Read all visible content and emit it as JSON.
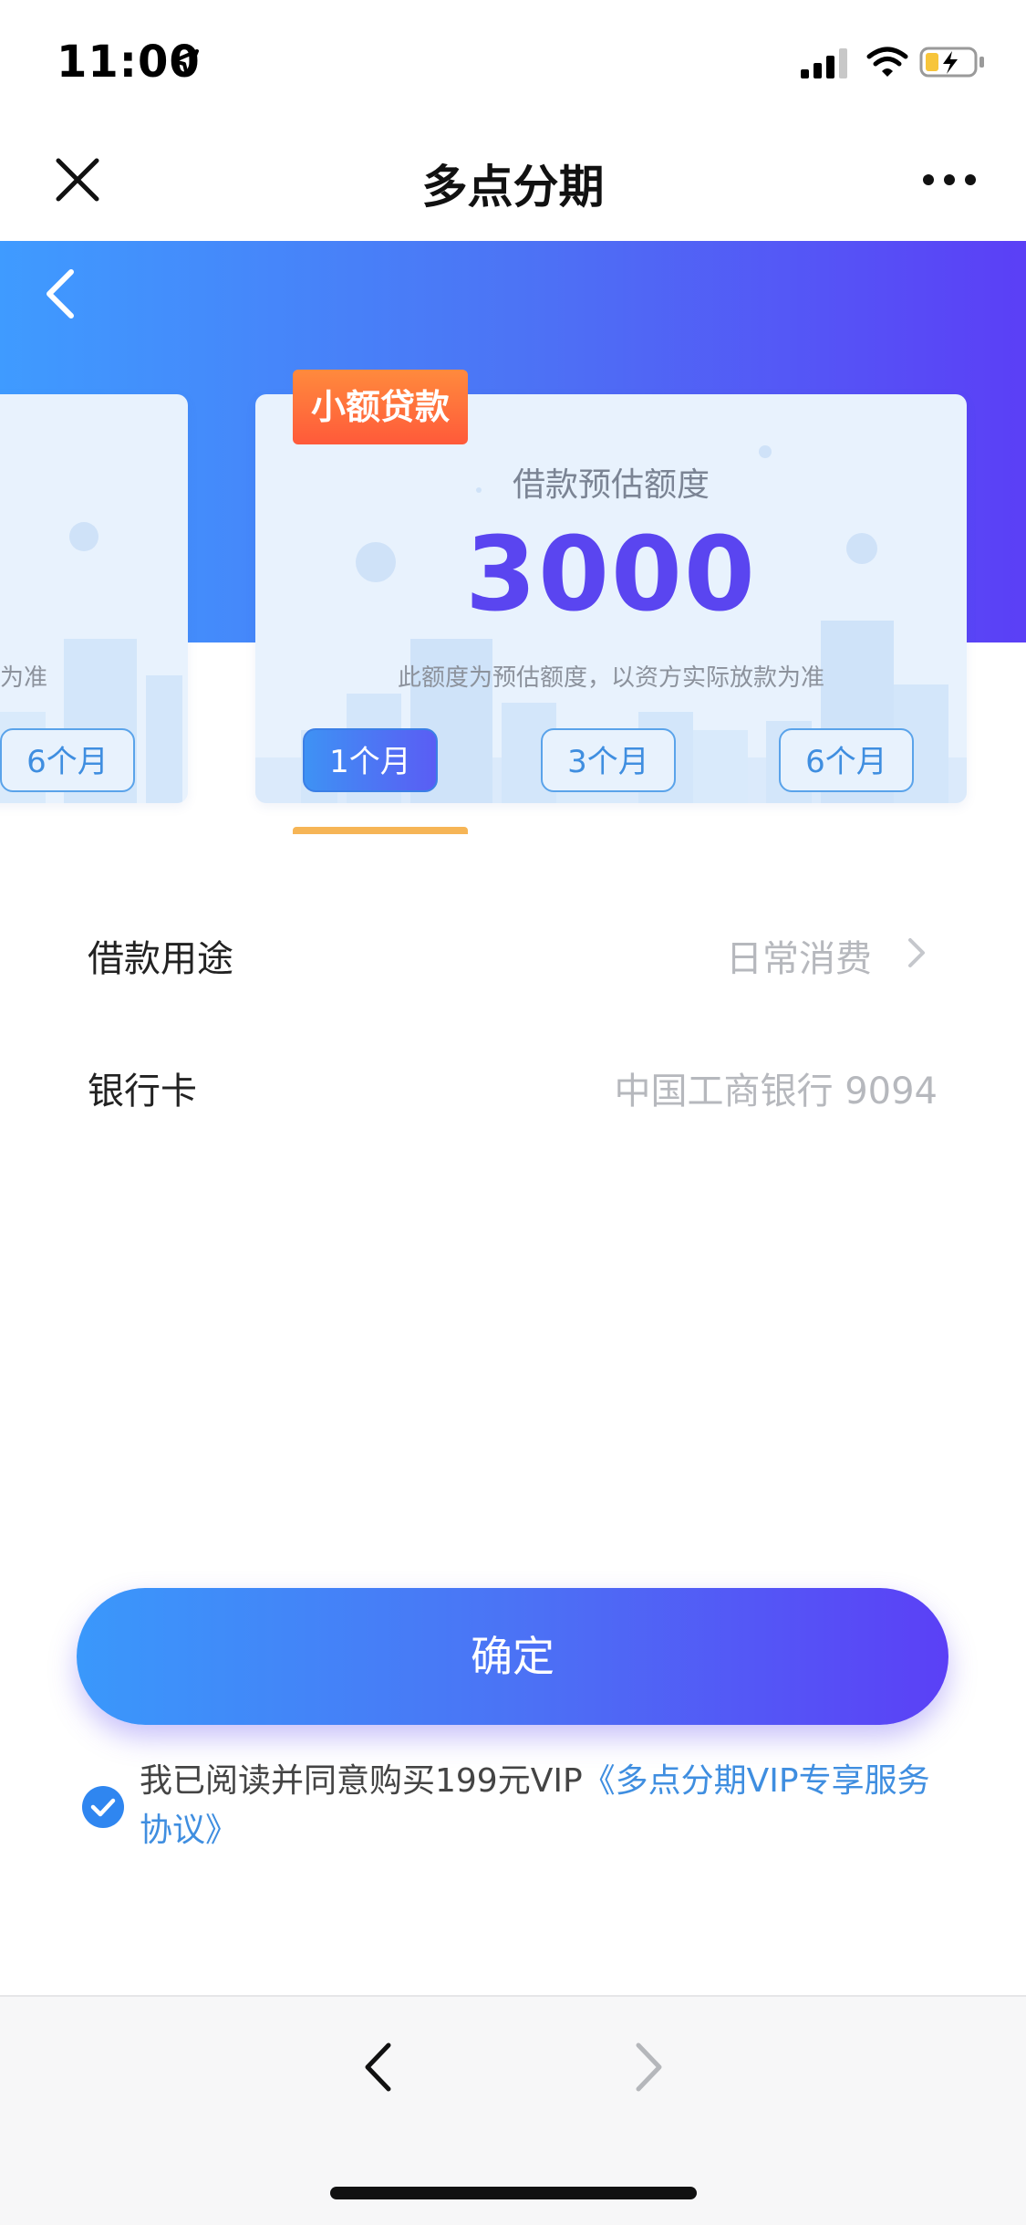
{
  "status_bar": {
    "time": "11:00"
  },
  "nav": {
    "title": "多点分期"
  },
  "loan_card": {
    "tag": "小额贷款",
    "estimate_label": "借款预估额度",
    "amount": "3000",
    "note": "此额度为预估额度，以资方实际放款为准",
    "periods": [
      "1个月",
      "3个月",
      "6个月"
    ],
    "selected_period": "1个月"
  },
  "left_card": {
    "note_fragment": "为准",
    "period": "6个月"
  },
  "form": {
    "purpose_label": "借款用途",
    "purpose_value": "日常消费",
    "bank_label": "银行卡",
    "bank_value": "中国工商银行 9094"
  },
  "confirm_button": "确定",
  "agreement": {
    "text": "我已阅读并同意购买199元VIP",
    "link": "《多点分期VIP专享服务协议》",
    "checked": true
  },
  "colors": {
    "accent_blue": "#3f8ee0",
    "brand_purple": "#5a45f0",
    "tag_orange": "#ff6b3a"
  }
}
